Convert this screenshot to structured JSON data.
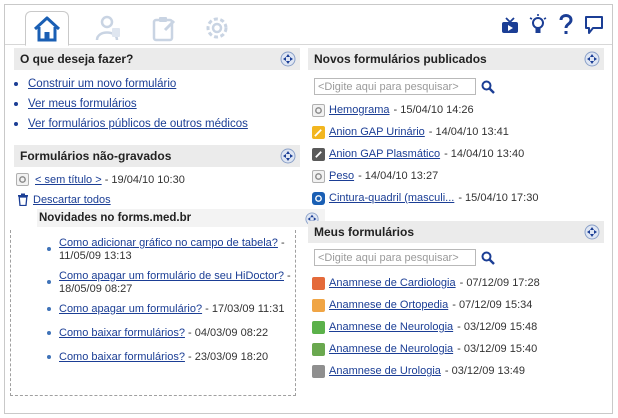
{
  "topbar": {
    "tabs": [
      {
        "icon": "home-icon",
        "active": true
      },
      {
        "icon": "doctor-icon",
        "active": false
      },
      {
        "icon": "clipboard-icon",
        "active": false
      },
      {
        "icon": "gear-icon",
        "active": false
      }
    ],
    "right_icons": [
      "tv-icon",
      "lightbulb-icon",
      "help-icon",
      "chat-icon"
    ]
  },
  "left": {
    "what_todo": {
      "title": "O que deseja fazer?",
      "links": [
        "Construir um novo formulário",
        "Ver meus formulários",
        "Ver formulários públicos de outros médicos"
      ]
    },
    "unsaved": {
      "title": "Formulários não-gravados",
      "item": {
        "label": "< sem título >",
        "meta": " - 19/04/10 10:30"
      },
      "discard_label": "Descartar todos"
    },
    "news": {
      "title": "Novidades no forms.med.br",
      "items": [
        {
          "label": "Como adicionar gráfico no campo de tabela?",
          "meta": " - 11/05/09 13:13"
        },
        {
          "label": "Como apagar um formulário de seu HiDoctor?",
          "meta": " - 18/05/09 08:27"
        },
        {
          "label": "Como apagar um formulário?",
          "meta": " - 17/03/09 11:31"
        },
        {
          "label": "Como baixar formulários?",
          "meta": " - 04/03/09 08:22"
        },
        {
          "label": "Como baixar formulários?",
          "meta": " - 23/03/09 18:20"
        }
      ]
    }
  },
  "right": {
    "published": {
      "title": "Novos formulários publicados",
      "search_placeholder": "<Digite aqui para pesquisar>",
      "items": [
        {
          "label": "Hemograma",
          "meta": " - 15/04/10 14:26",
          "icon": "gear"
        },
        {
          "label": "Anion GAP Urinário",
          "meta": " - 14/04/10 13:41",
          "icon": "yellow"
        },
        {
          "label": "Anion GAP Plasmático",
          "meta": " - 14/04/10 13:40",
          "icon": "wrench"
        },
        {
          "label": "Peso",
          "meta": " - 14/04/10 13:27",
          "icon": "gear"
        },
        {
          "label": "Cintura-quadril (masculi...",
          "meta": " - 15/04/10 17:30",
          "icon": "circle"
        }
      ]
    },
    "mine": {
      "title": "Meus formulários",
      "search_placeholder": "<Digite aqui para pesquisar>",
      "items": [
        {
          "label": "Anamnese de Cardiologia",
          "meta": " - 07/12/09 17:28",
          "icon": "red"
        },
        {
          "label": "Anamnese de Ortopedia",
          "meta": " - 07/12/09 15:34",
          "icon": "orange"
        },
        {
          "label": "Anamnese de Neurologia",
          "meta": " - 03/12/09 15:48",
          "icon": "green"
        },
        {
          "label": "Anamnese de Neurologia",
          "meta": " - 03/12/09 15:40",
          "icon": "green2"
        },
        {
          "label": "Anamnese de Urologia",
          "meta": " - 03/12/09 13:49",
          "icon": "grey"
        }
      ]
    }
  },
  "colors": {
    "link": "#1b3e95",
    "header_bg": "#ebebeb",
    "accent": "#1a5fb4"
  }
}
